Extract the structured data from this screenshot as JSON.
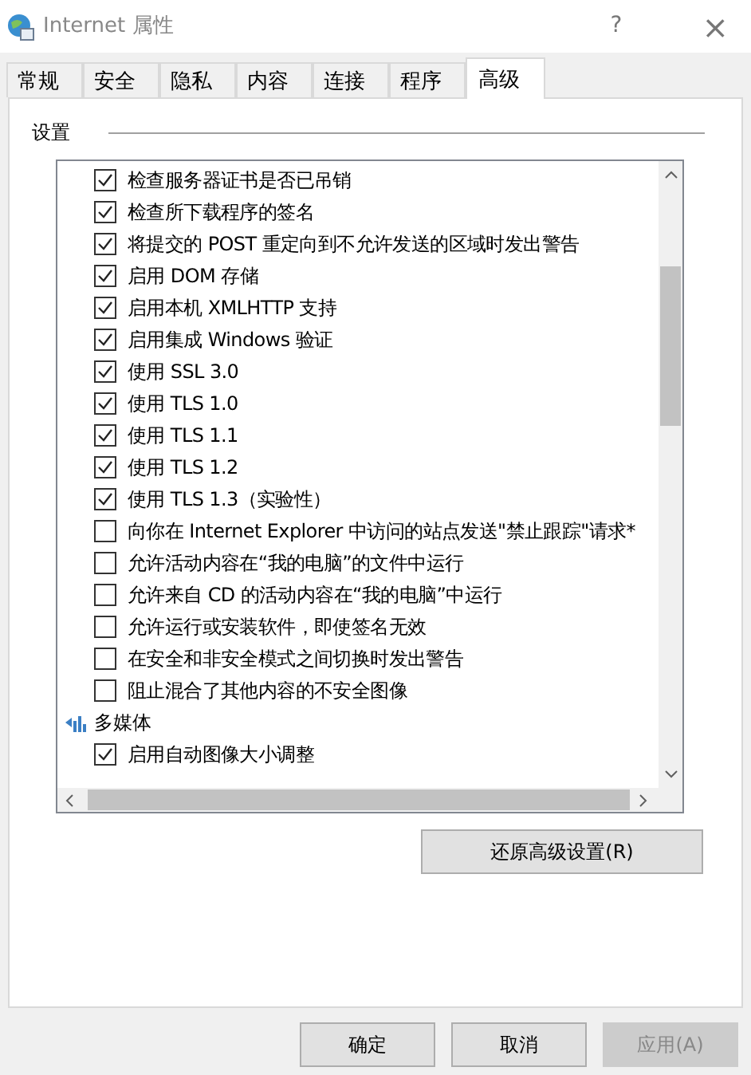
{
  "window": {
    "title": "Internet 属性",
    "help": "?",
    "close": "×"
  },
  "tabs": [
    {
      "label": "常规",
      "selected": false
    },
    {
      "label": "安全",
      "selected": false
    },
    {
      "label": "隐私",
      "selected": false
    },
    {
      "label": "内容",
      "selected": false
    },
    {
      "label": "连接",
      "selected": false
    },
    {
      "label": "程序",
      "selected": false
    },
    {
      "label": "高级",
      "selected": true
    }
  ],
  "group_label": "设置",
  "settings": [
    {
      "kind": "checkbox",
      "label": "检查服务器证书是否已吊销",
      "checked": true
    },
    {
      "kind": "checkbox",
      "label": "检查所下载程序的签名",
      "checked": true
    },
    {
      "kind": "checkbox",
      "label": "将提交的 POST 重定向到不允许发送的区域时发出警告",
      "checked": true
    },
    {
      "kind": "checkbox",
      "label": "启用 DOM 存储",
      "checked": true
    },
    {
      "kind": "checkbox",
      "label": "启用本机 XMLHTTP 支持",
      "checked": true
    },
    {
      "kind": "checkbox",
      "label": "启用集成 Windows 验证",
      "checked": true
    },
    {
      "kind": "checkbox",
      "label": "使用 SSL 3.0",
      "checked": true
    },
    {
      "kind": "checkbox",
      "label": "使用 TLS 1.0",
      "checked": true
    },
    {
      "kind": "checkbox",
      "label": "使用 TLS 1.1",
      "checked": true
    },
    {
      "kind": "checkbox",
      "label": "使用 TLS 1.2",
      "checked": true
    },
    {
      "kind": "checkbox",
      "label": "使用 TLS 1.3（实验性）",
      "checked": true
    },
    {
      "kind": "checkbox",
      "label": "向你在 Internet Explorer 中访问的站点发送\"禁止跟踪\"请求*",
      "checked": false
    },
    {
      "kind": "checkbox",
      "label": "允许活动内容在“我的电脑”的文件中运行",
      "checked": false
    },
    {
      "kind": "checkbox",
      "label": "允许来自 CD 的活动内容在“我的电脑”中运行",
      "checked": false
    },
    {
      "kind": "checkbox",
      "label": "允许运行或安装软件，即使签名无效",
      "checked": false
    },
    {
      "kind": "checkbox",
      "label": "在安全和非安全模式之间切换时发出警告",
      "checked": false
    },
    {
      "kind": "checkbox",
      "label": "阻止混合了其他内容的不安全图像",
      "checked": false
    },
    {
      "kind": "category",
      "label": "多媒体"
    },
    {
      "kind": "checkbox",
      "label": "启用自动图像大小调整",
      "checked": true
    }
  ],
  "restore_button": "还原高级设置(R)",
  "buttons": [
    {
      "label": "确定",
      "disabled": false
    },
    {
      "label": "取消",
      "disabled": false
    },
    {
      "label": "应用(A)",
      "disabled": true
    }
  ]
}
